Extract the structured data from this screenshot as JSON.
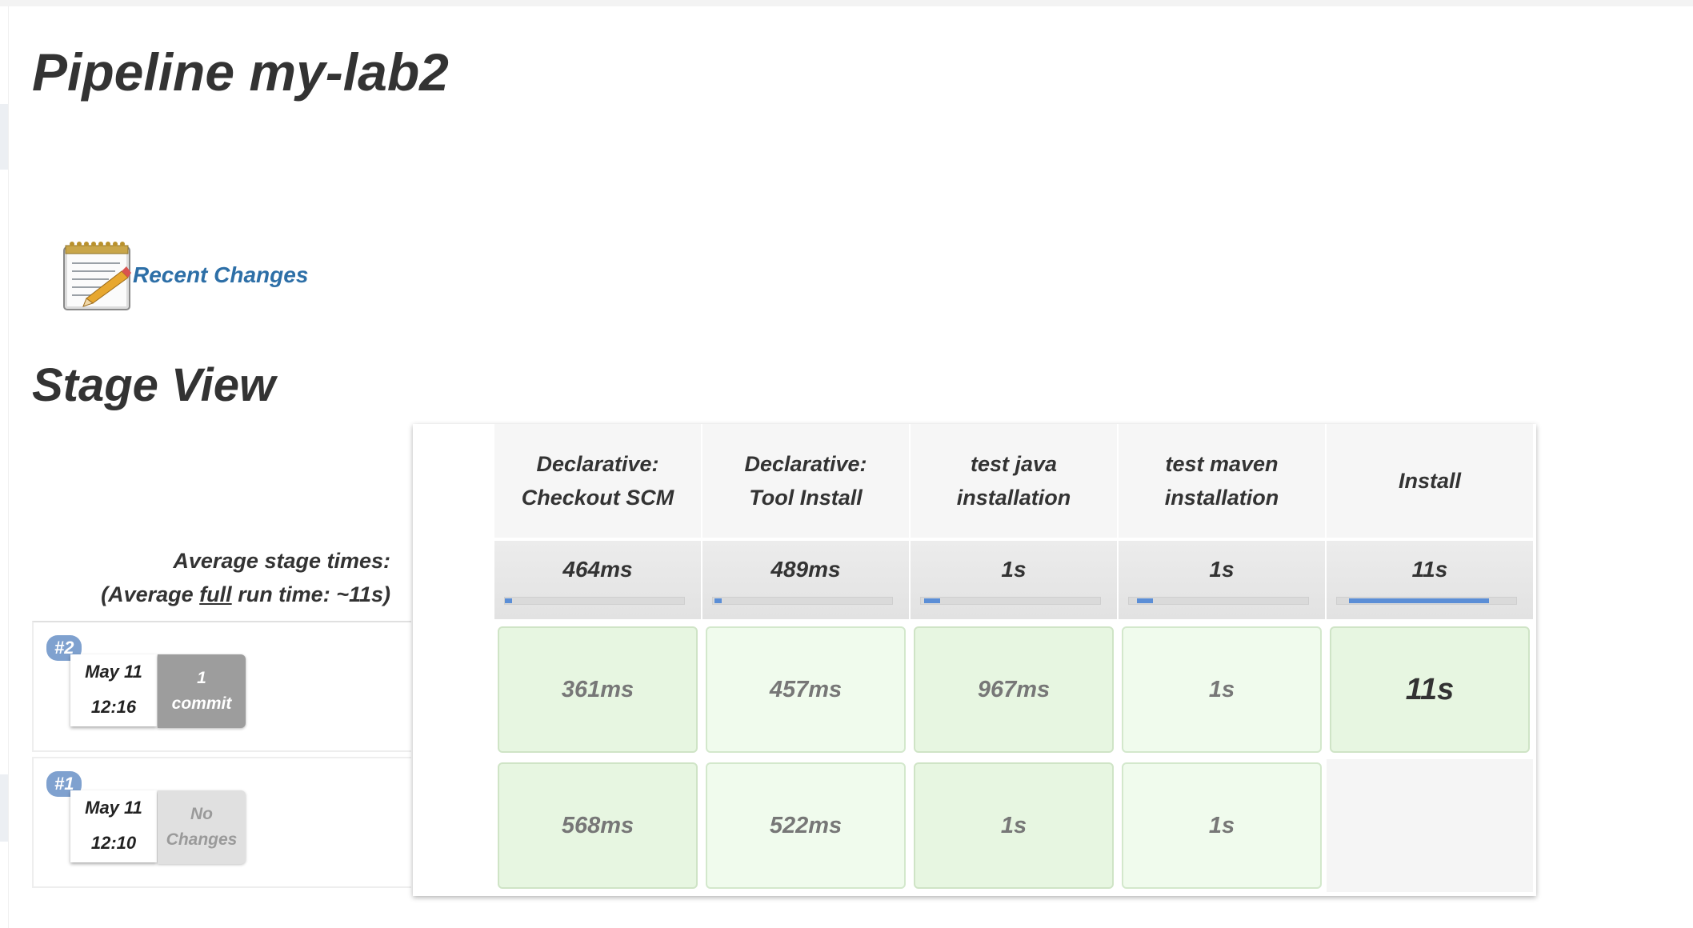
{
  "page": {
    "title": "Pipeline my-lab2",
    "recent_changes_label": "Recent Changes",
    "stage_view_title": "Stage View"
  },
  "average": {
    "line1": "Average stage times:",
    "line2_prefix": "(Average ",
    "line2_full": "full",
    "line2_suffix": " run time: ~11s)"
  },
  "stages": [
    {
      "line1": "Declarative:",
      "line2": "Checkout SCM",
      "avg": "464ms",
      "avg_fraction": 0.04
    },
    {
      "line1": "Declarative:",
      "line2": "Tool Install",
      "avg": "489ms",
      "avg_fraction": 0.04
    },
    {
      "line1": "test java",
      "line2": "installation",
      "avg": "1s",
      "avg_fraction": 0.09
    },
    {
      "line1": "test maven",
      "line2": "installation",
      "avg": "1s",
      "avg_fraction": 0.09
    },
    {
      "line1": "Install",
      "line2": "",
      "avg": "11s",
      "avg_fraction": 0.78
    }
  ],
  "runs": [
    {
      "badge": "#2",
      "date": "May 11",
      "time": "12:16",
      "changes_line1": "1",
      "changes_line2": "commit",
      "cells": [
        "361ms",
        "457ms",
        "967ms",
        "1s",
        "11s"
      ]
    },
    {
      "badge": "#1",
      "date": "May 11",
      "time": "12:10",
      "changes_line1": "No",
      "changes_line2": "Changes",
      "cells": [
        "568ms",
        "522ms",
        "1s",
        "1s"
      ]
    }
  ],
  "colors": {
    "link": "#2d6fa7",
    "badge": "#7fa1cf",
    "success_cell": "#e7f6e1",
    "progress": "#5b8ed6"
  }
}
